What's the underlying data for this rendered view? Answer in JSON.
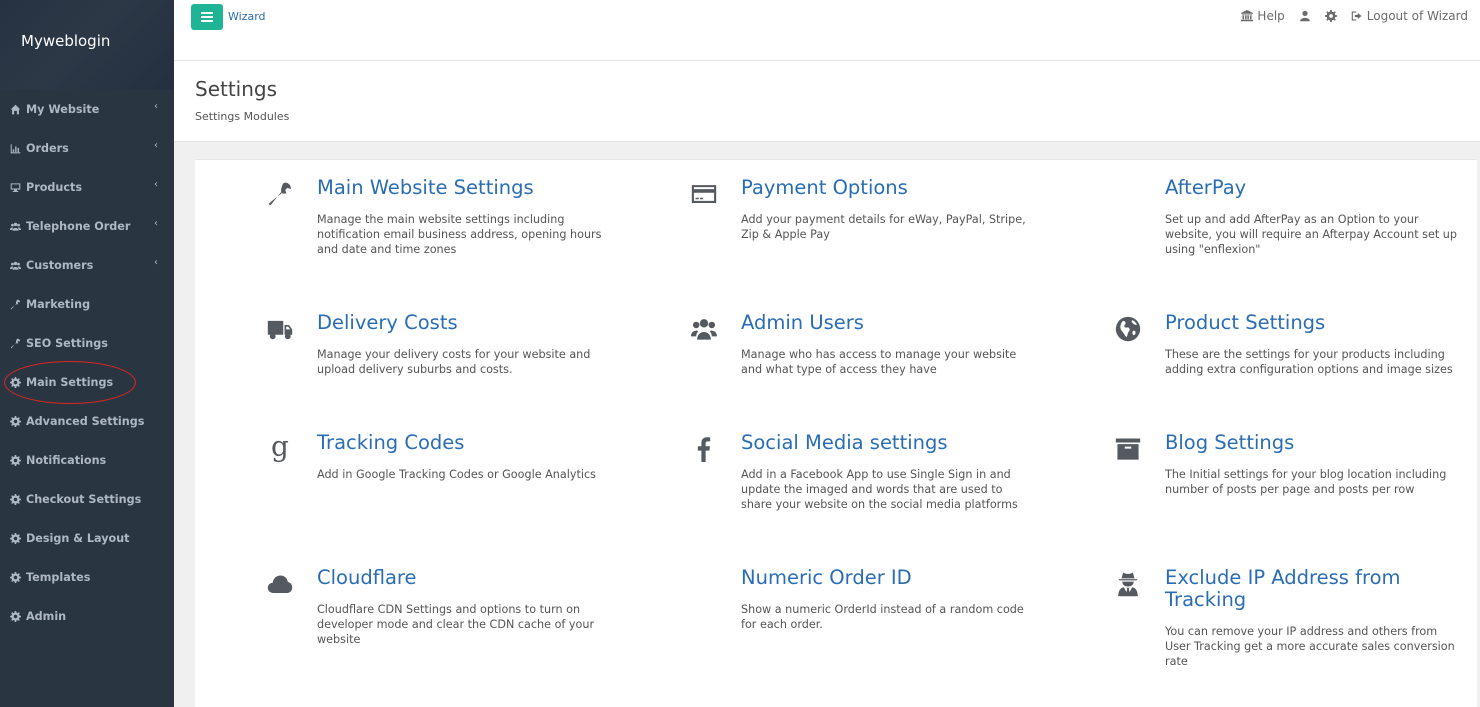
{
  "brand": {
    "name": "Myweblogin"
  },
  "sidebar": {
    "items": [
      {
        "label": "My Website",
        "icon": "home-icon",
        "has_submenu": true
      },
      {
        "label": "Orders",
        "icon": "bar-chart-icon",
        "has_submenu": true
      },
      {
        "label": "Products",
        "icon": "desktop-icon",
        "has_submenu": true
      },
      {
        "label": "Telephone Order",
        "icon": "users-icon",
        "has_submenu": true
      },
      {
        "label": "Customers",
        "icon": "users-icon",
        "has_submenu": true
      },
      {
        "label": "Marketing",
        "icon": "wrench-icon",
        "has_submenu": false
      },
      {
        "label": "SEO Settings",
        "icon": "wrench-icon",
        "has_submenu": false
      },
      {
        "label": "Main Settings",
        "icon": "gear-icon",
        "has_submenu": false,
        "highlighted": true
      },
      {
        "label": "Advanced Settings",
        "icon": "gear-icon",
        "has_submenu": false
      },
      {
        "label": "Notifications",
        "icon": "gear-icon",
        "has_submenu": false
      },
      {
        "label": "Checkout Settings",
        "icon": "gear-icon",
        "has_submenu": false
      },
      {
        "label": "Design & Layout",
        "icon": "gear-icon",
        "has_submenu": false
      },
      {
        "label": "Templates",
        "icon": "gear-icon",
        "has_submenu": false
      },
      {
        "label": "Admin",
        "icon": "gear-icon",
        "has_submenu": false
      }
    ],
    "chevron": "‹"
  },
  "topbar": {
    "menu_icon": "hamburger-icon",
    "wizard_label": "Wizard",
    "help_label": "Help",
    "logout_label": "Logout of Wizard",
    "accent_color": "#1fb496"
  },
  "header": {
    "title": "Settings",
    "subtitle": "Settings Modules"
  },
  "modules": [
    {
      "title": "Main Website Settings",
      "icon": "wrench-icon",
      "description": "Manage the main website settings including notification email business address, opening hours and date and time zones"
    },
    {
      "title": "Payment Options",
      "icon": "credit-card-icon",
      "description": "Add your payment details for eWay, PayPal, Stripe, Zip & Apple Pay"
    },
    {
      "title": "AfterPay",
      "icon": "",
      "description": "Set up and add AfterPay as an Option to your website, you will require an Afterpay Account set up using \"enflexion\""
    },
    {
      "title": "Delivery Costs",
      "icon": "truck-icon",
      "description": "Manage your delivery costs for your website and upload delivery suburbs and costs."
    },
    {
      "title": "Admin Users",
      "icon": "users-icon",
      "description": "Manage who has access to manage your website and what type of access they have"
    },
    {
      "title": "Product Settings",
      "icon": "globe-icon",
      "description": "These are the settings for your products including adding extra configuration options and image sizes"
    },
    {
      "title": "Tracking Codes",
      "icon": "google-icon",
      "description": "Add in Google Tracking Codes or Google Analytics"
    },
    {
      "title": "Social Media settings",
      "icon": "facebook-icon",
      "description": "Add in a Facebook App to use Single Sign in and update the imaged and words that are used to share your website on the social media platforms"
    },
    {
      "title": "Blog Settings",
      "icon": "archive-icon",
      "description": "The Initial settings for your blog location including number of posts per page and posts per row"
    },
    {
      "title": "Cloudflare",
      "icon": "cloud-icon",
      "description": "Cloudflare CDN Settings and options to turn on developer mode and clear the CDN cache of your website"
    },
    {
      "title": "Numeric Order ID",
      "icon": "",
      "description": "Show a numeric OrderId instead of a random code for each order."
    },
    {
      "title": "Exclude IP Address from Tracking",
      "icon": "user-secret-icon",
      "description": "You can remove your IP address and others from User Tracking get a more accurate sales conversion rate"
    }
  ],
  "colors": {
    "sidebar_bg": "#2a3542",
    "link_blue": "#2a6db5",
    "highlight_red": "#e0261f"
  }
}
